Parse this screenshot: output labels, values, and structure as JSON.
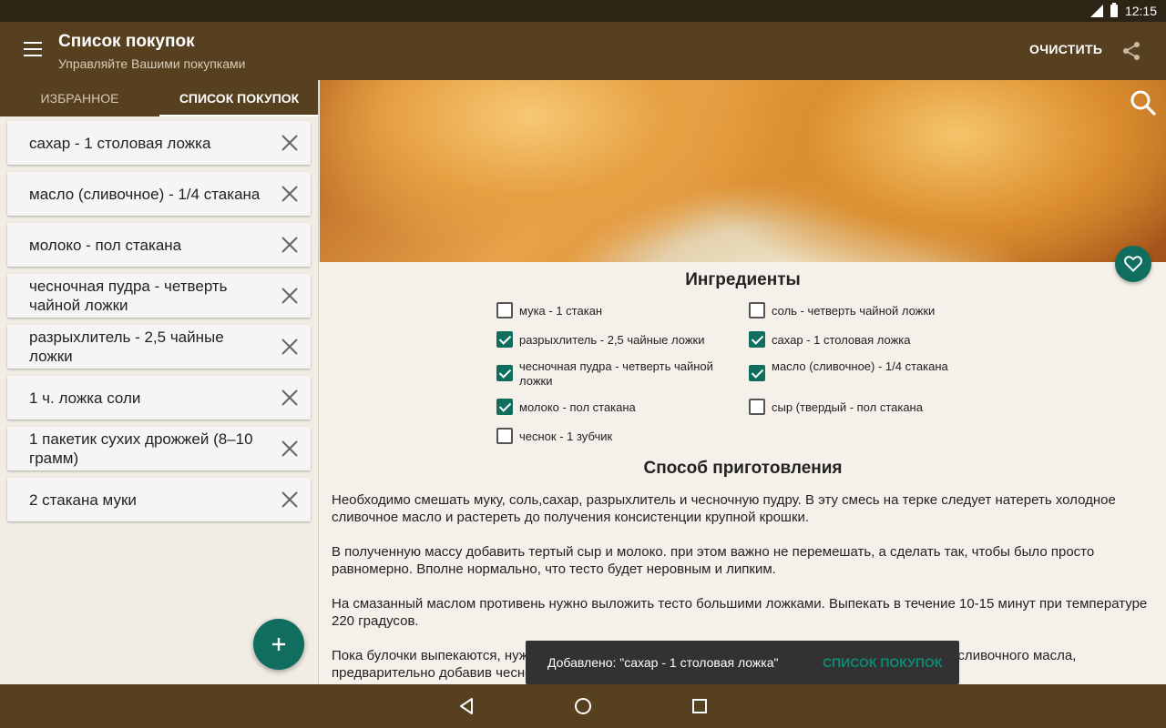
{
  "status_bar": {
    "time": "12:15"
  },
  "app_bar": {
    "title": "Список покупок",
    "subtitle": "Управляйте Вашими покупками",
    "clear_label": "ОЧИСТИТЬ"
  },
  "tabs": [
    {
      "label": "ИЗБРАННОЕ",
      "active": false
    },
    {
      "label": "СПИСОК ПОКУПОК",
      "active": true
    }
  ],
  "shopping_list": [
    "сахар - 1 столовая ложка",
    "масло (сливочное) - 1/4 стакана",
    "молоко - пол стакана",
    "чесночная пудра - четверть чайной ложки",
    "разрыхлитель - 2,5 чайные ложки",
    "1 ч. ложка соли",
    "1 пакетик сухих дрожжей (8–10 грамм)",
    "2 стакана муки"
  ],
  "recipe": {
    "ingredients_title": "Ингредиенты",
    "ingredients": [
      {
        "label": "мука - 1 стакан",
        "checked": false
      },
      {
        "label": "соль - четверть чайной ложки",
        "checked": false
      },
      {
        "label": "разрыхлитель - 2,5 чайные ложки",
        "checked": true
      },
      {
        "label": "сахар - 1 столовая ложка",
        "checked": true
      },
      {
        "label": "чесночная пудра - четверть чайной ложки",
        "checked": true
      },
      {
        "label": "масло (сливочное) - 1/4 стакана",
        "checked": true
      },
      {
        "label": "молоко - пол стакана",
        "checked": true
      },
      {
        "label": "сыр (твердый - пол стакана",
        "checked": false
      },
      {
        "label": "чеснок - 1 зубчик",
        "checked": false
      }
    ],
    "method_title": "Способ приготовления",
    "paragraphs": [
      "Необходимо смешать муку, соль,сахар, разрыхлитель и чесночную пудру. В эту смесь на терке следует натереть холодное сливочное масло и растереть до получения консистенции крупной крошки.",
      "В полученную массу добавить тертый сыр и молоко. при этом важно не перемешать, а сделать так, чтобы было просто равномерно. Вполне нормально, что тесто будет неровным и липким.",
      "На смазанный маслом противень нужно выложить тесто большими ложками. Выпекать в течение 10-15 минут при температуре 220 градусов.",
      "Пока булочки выпекаются, нужно растопить в микроволновке или на плите 2 столовыми ложками сливочного масла, предварительно добавив чесночную пудру. Готовые булочки нужно смазать чесночным"
    ]
  },
  "snackbar": {
    "message": "Добавлено: \"сахар - 1 столовая ложка\"",
    "action": "СПИСОК ПОКУПОК"
  },
  "colors": {
    "primary": "#56401f",
    "accent": "#0f6e5e",
    "status_bar": "#2e2416"
  },
  "icons": [
    "menu-icon",
    "share-icon",
    "search-icon",
    "heart-icon",
    "close-icon",
    "add-icon",
    "back-icon",
    "home-icon",
    "recents-icon"
  ]
}
